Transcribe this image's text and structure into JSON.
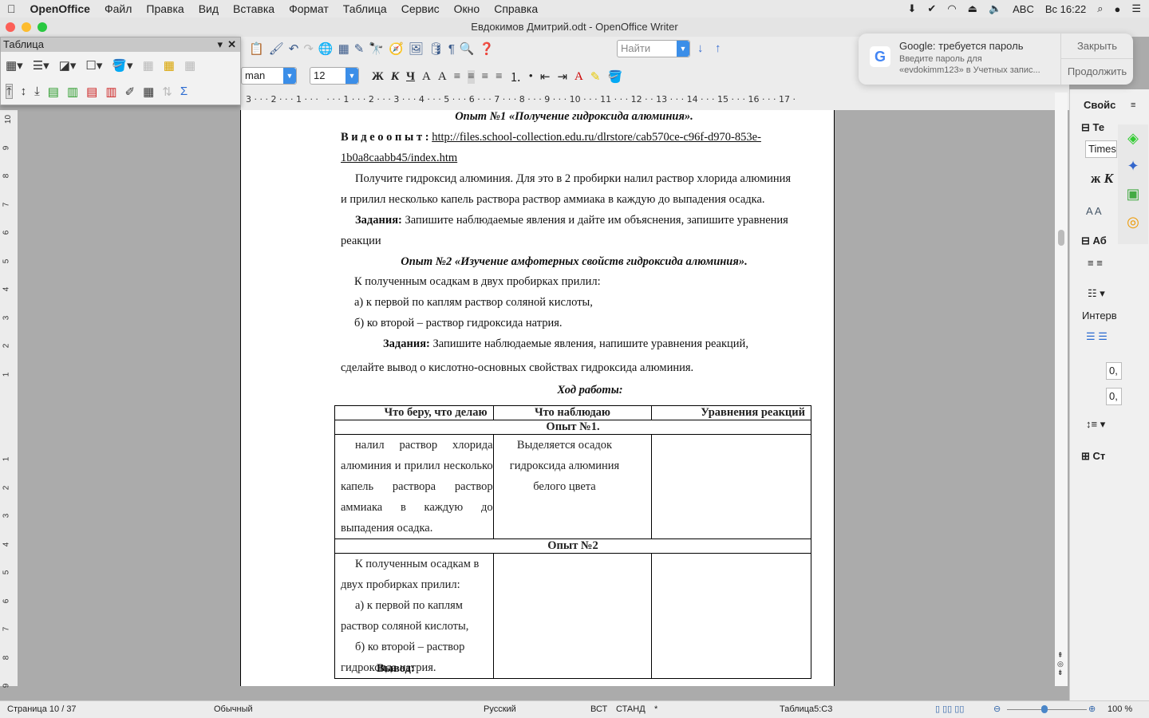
{
  "menubar": {
    "app": "OpenOffice",
    "items": [
      "Файл",
      "Правка",
      "Вид",
      "Вставка",
      "Формат",
      "Таблица",
      "Сервис",
      "Окно",
      "Справка"
    ],
    "input_source": "ABC",
    "clock": "Вс 16:22"
  },
  "window": {
    "title": "Евдокимов Дмитрий.odt - OpenOffice Writer"
  },
  "toolbar": {
    "find_placeholder": "Найти",
    "font_name": "man",
    "font_size": "12",
    "bold": "Ж",
    "italic": "К",
    "underline": "Ч"
  },
  "table_toolbar": {
    "title": "Таблица"
  },
  "ruler": {
    "text": "3 · · · 2 · · · 1 · · ·   · · · 1 · · · 2 · · · 3 · · · 4 · · · 5 · · · 6 · · · 7 · · · 8 · · · 9 · · · 10 · · · 11 · · · 12 · · 13 · · · 14 · · · 15 · · · 16 · · · 17 ·"
  },
  "notification": {
    "title": "Google: требуется пароль",
    "body1": "Введите пароль для",
    "body2": "«evdokimm123» в Учетных запис...",
    "close": "Закрыть",
    "continue": "Продолжить"
  },
  "sidebar": {
    "title": "Свойс",
    "section_text": "Те",
    "font": "Times",
    "bold": "ж",
    "italic": "К",
    "section_para": "Аб",
    "spacing": "Интерв",
    "val1": "0,",
    "val2": "0,",
    "section_page": "Ст"
  },
  "document": {
    "heading1": "Опыт №1 «Получение гидроксида алюминия».",
    "video_label": "В и д е о о п ы т :",
    "video_link1": "http://files.school-collection.edu.ru/dlrstore/cab570ce-c96f-d970-853e-",
    "video_link2": "1b0a8caabb45/index.htm",
    "p1a": "Получите гидроксид алюминия. Для это в 2 пробирки налил раствор хлорида алюминия",
    "p1b": "и прилил несколько капель раствора раствор аммиака в каждую до выпадения осадка.",
    "task_label": "Задания:",
    "task1a": " Запишите наблюдаемые явления и дайте им объяснения, запишите уравнения",
    "task1b": "реакции",
    "heading2": "Опыт №2 «Изучение амфотерных свойств гидроксида алюминия».",
    "p2a": "К полученным осадкам в двух пробирках прилил:",
    "p2b": "а) к первой по каплям раствор соляной кислоты,",
    "p2c": "б) ко второй – раствор гидроксида натрия.",
    "task2a": " Запишите наблюдаемые явления, напишите уравнения реакций,",
    "task2b": "сделайте вывод о кислотно-основных свойствах гидроксида алюминия.",
    "progress_heading": "Ход работы:",
    "table": {
      "headers": [
        "Что беру, что делаю",
        "Что наблюдаю",
        "Уравнения реакций"
      ],
      "exp1": "Опыт №1.",
      "exp1_do": "налил раствор хлорида алюминия и прилил несколько капель раствора раствор аммиака в каждую до выпадения осадка.",
      "exp1_see": "Выделяется осадок гидроксида алюминия белого цвета",
      "exp2": "Опыт №2",
      "exp2_do": [
        "К полученным осадкам в двух пробирках прилил:",
        "а) к первой по каплям раствор соляной кислоты,",
        "б) ко второй – раствор гидроксида натрия."
      ]
    },
    "conclusion": "Вывод:"
  },
  "statusbar": {
    "page": "Страница  10 / 37",
    "style": "Обычный",
    "language": "Русский",
    "insert": "ВСТ",
    "select": "СТАНД",
    "modified": "*",
    "cell": "Таблица5:C3",
    "zoom": "100 %",
    "zoom_level_percent": 100
  }
}
